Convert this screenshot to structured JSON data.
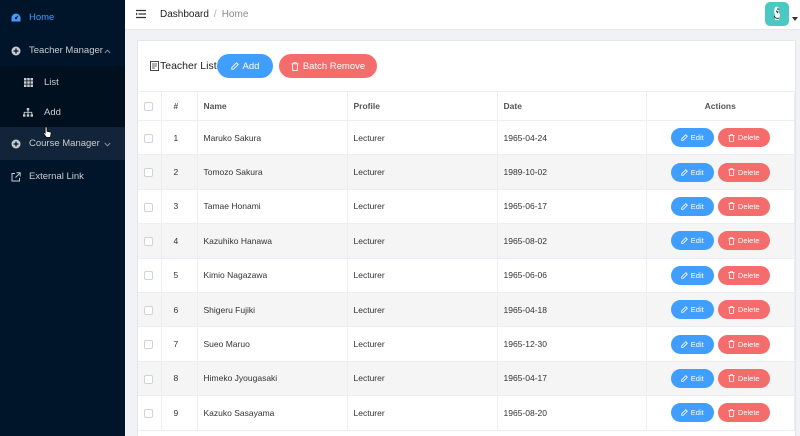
{
  "sidebar": {
    "items": [
      {
        "label": "Home",
        "icon": "dashboard-icon"
      },
      {
        "label": "Teacher Manager",
        "icon": "plus-circle-icon"
      },
      {
        "label": "List",
        "icon": "grid-icon"
      },
      {
        "label": "Add",
        "icon": "sitemap-icon"
      },
      {
        "label": "Course Manager",
        "icon": "plus-circle-icon"
      },
      {
        "label": "External Link",
        "icon": "external-link-icon"
      }
    ]
  },
  "header": {
    "breadcrumb": [
      "Dashboard",
      "Home"
    ]
  },
  "toolbar": {
    "title": "Teacher List",
    "add_label": "Add",
    "batch_remove_label": "Batch Remove"
  },
  "table": {
    "headers": [
      "#",
      "Name",
      "Profile",
      "Date",
      "Actions"
    ],
    "edit_label": "Edit",
    "delete_label": "Delete",
    "rows": [
      {
        "num": "1",
        "name": "Maruko Sakura",
        "profile": "Lecturer",
        "date": "1965-04-24"
      },
      {
        "num": "2",
        "name": "Tomozo Sakura",
        "profile": "Lecturer",
        "date": "1989-10-02"
      },
      {
        "num": "3",
        "name": "Tamae Honami",
        "profile": "Lecturer",
        "date": "1965-06-17"
      },
      {
        "num": "4",
        "name": "Kazuhiko Hanawa",
        "profile": "Lecturer",
        "date": "1965-08-02"
      },
      {
        "num": "5",
        "name": "Kimio Nagazawa",
        "profile": "Lecturer",
        "date": "1965-06-06"
      },
      {
        "num": "6",
        "name": "Shigeru Fujiki",
        "profile": "Lecturer",
        "date": "1965-04-18"
      },
      {
        "num": "7",
        "name": "Sueo Maruo",
        "profile": "Lecturer",
        "date": "1965-12-30"
      },
      {
        "num": "8",
        "name": "Himeko Jyougasaki",
        "profile": "Lecturer",
        "date": "1965-04-17"
      },
      {
        "num": "9",
        "name": "Kazuko Sasayama",
        "profile": "Lecturer",
        "date": "1965-08-20"
      }
    ]
  },
  "colors": {
    "sidebar_bg": "#001529",
    "accent": "#409eff",
    "danger": "#f56c6c",
    "avatar_bg": "#4cc8c3"
  }
}
